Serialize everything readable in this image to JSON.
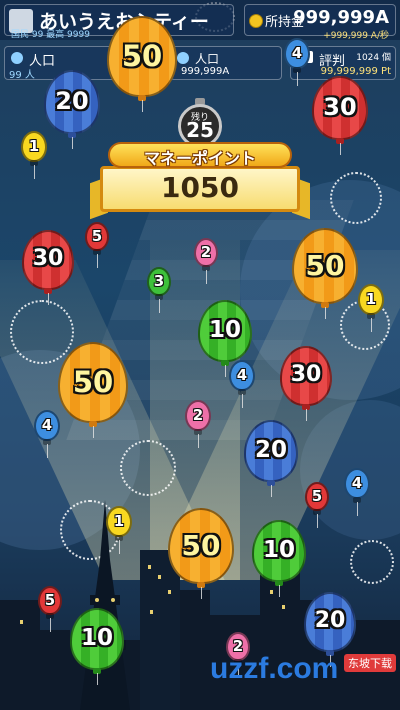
{
  "hud": {
    "city_name": "あいうえおシティー",
    "city_sub": "国民 99 最高 9999",
    "money_label": "所持金",
    "money_value": "999,999A",
    "money_rate": "+999,999 A/秒",
    "population_label": "人口",
    "population_value": "99 人",
    "mid_label": "人口",
    "mid_value": "999,999A",
    "mid_rate": "/秒",
    "approval_label": "評判",
    "approval_count": "1024 個",
    "approval_value": "99,999,999 Pt"
  },
  "timer": {
    "label": "残り",
    "value": "25"
  },
  "banner": {
    "title": "マネーポイント",
    "value": "1050"
  },
  "balloons": [
    {
      "id": "orange-50-top",
      "kind": "big",
      "color": "orange",
      "value": "50"
    },
    {
      "id": "blue-20-top",
      "kind": "big",
      "color": "blue",
      "value": "20"
    },
    {
      "id": "red-30-top",
      "kind": "big",
      "color": "red",
      "value": "30"
    },
    {
      "id": "red-30-left",
      "kind": "big",
      "color": "red",
      "value": "30"
    },
    {
      "id": "orange-50-right",
      "kind": "big",
      "color": "orange",
      "value": "50"
    },
    {
      "id": "green-10-mid",
      "kind": "big",
      "color": "green",
      "value": "10"
    },
    {
      "id": "orange-50-left",
      "kind": "big",
      "color": "orange",
      "value": "50"
    },
    {
      "id": "red-30-right",
      "kind": "big",
      "color": "red",
      "value": "30"
    },
    {
      "id": "blue-20-mid",
      "kind": "big",
      "color": "blue",
      "value": "20"
    },
    {
      "id": "orange-50-bottom",
      "kind": "big",
      "color": "orange",
      "value": "50"
    },
    {
      "id": "green-10-right",
      "kind": "big",
      "color": "green",
      "value": "10"
    },
    {
      "id": "green-10-bottom",
      "kind": "big",
      "color": "green",
      "value": "10"
    },
    {
      "id": "blue-20-bottom",
      "kind": "big",
      "color": "blue",
      "value": "20"
    },
    {
      "id": "small-yellow-1-left",
      "kind": "small",
      "color": "s-yellow",
      "value": "1"
    },
    {
      "id": "small-blue-4-top",
      "kind": "small",
      "color": "s-blue",
      "value": "4"
    },
    {
      "id": "small-red-5-left",
      "kind": "small",
      "color": "s-red",
      "value": "5"
    },
    {
      "id": "small-pink-2-top",
      "kind": "small",
      "color": "s-pink",
      "value": "2"
    },
    {
      "id": "small-green-3",
      "kind": "small",
      "color": "s-green",
      "value": "3"
    },
    {
      "id": "small-yellow-1-right",
      "kind": "small",
      "color": "s-yellow",
      "value": "1"
    },
    {
      "id": "small-blue-4-mid",
      "kind": "small",
      "color": "s-blue",
      "value": "4"
    },
    {
      "id": "small-pink-2-mid",
      "kind": "small",
      "color": "s-pink",
      "value": "2"
    },
    {
      "id": "small-blue-4-left",
      "kind": "small",
      "color": "s-blue",
      "value": "4"
    },
    {
      "id": "small-red-5-right",
      "kind": "small",
      "color": "s-red",
      "value": "5"
    },
    {
      "id": "small-blue-4-right",
      "kind": "small",
      "color": "s-blue",
      "value": "4"
    },
    {
      "id": "small-yellow-1-bottom",
      "kind": "small",
      "color": "s-yellow",
      "value": "1"
    },
    {
      "id": "small-red-5-bottom",
      "kind": "small",
      "color": "s-red",
      "value": "5"
    },
    {
      "id": "small-pink-2-bottom",
      "kind": "small",
      "color": "s-pink",
      "value": "2"
    }
  ],
  "watermark": {
    "logo": "uzzf.com",
    "tag": "东坡下载"
  },
  "colors": {
    "sky": "#1b466a",
    "banner_gold": "#f0a818",
    "balloon_orange": "#f7b030",
    "balloon_blue": "#4a7dd8",
    "balloon_red": "#e84848",
    "balloon_green": "#4fcc3a"
  }
}
